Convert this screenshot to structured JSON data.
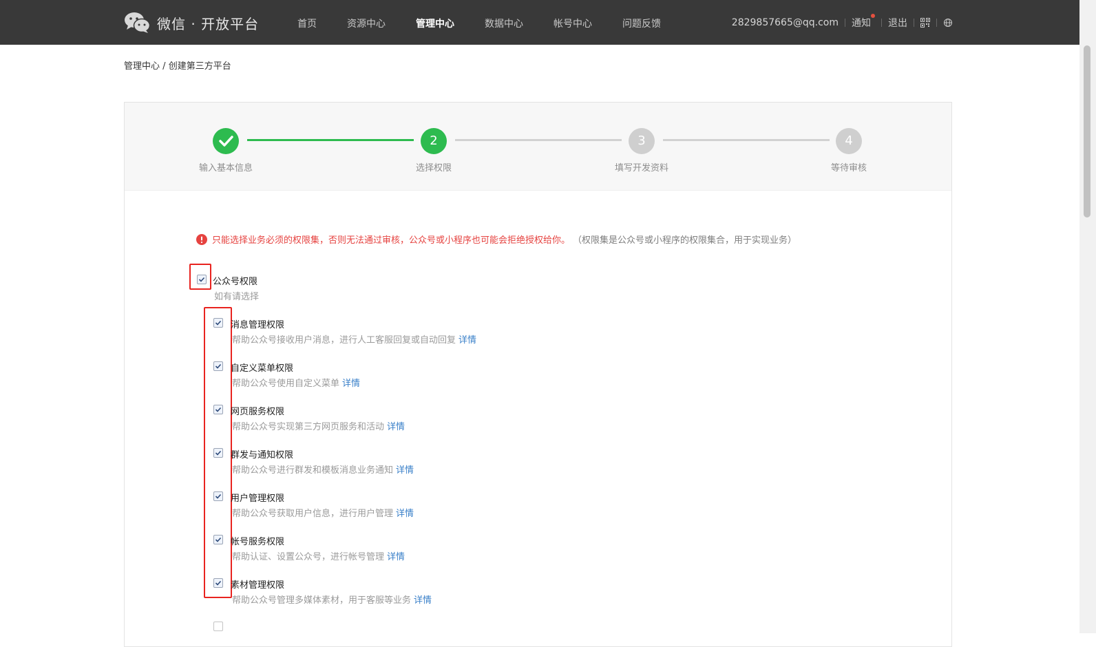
{
  "header": {
    "logo_text": "微信 · 开放平台",
    "nav": [
      {
        "label": "首页",
        "active": false
      },
      {
        "label": "资源中心",
        "active": false
      },
      {
        "label": "管理中心",
        "active": true
      },
      {
        "label": "数据中心",
        "active": false
      },
      {
        "label": "帐号中心",
        "active": false
      },
      {
        "label": "问题反馈",
        "active": false
      }
    ],
    "email": "2829857665@qq.com",
    "notify_label": "通知",
    "logout_label": "退出"
  },
  "breadcrumb": {
    "parent": "管理中心",
    "separator": "/",
    "current": "创建第三方平台"
  },
  "steps": [
    {
      "number": "1",
      "label": "输入基本信息",
      "status": "done"
    },
    {
      "number": "2",
      "label": "选择权限",
      "status": "current"
    },
    {
      "number": "3",
      "label": "填写开发资料",
      "status": "pending"
    },
    {
      "number": "4",
      "label": "等待审核",
      "status": "pending"
    }
  ],
  "warning": {
    "red_text": "只能选择业务必须的权限集，否则无法通过审核，公众号或小程序也可能会拒绝授权给你。",
    "gray_text": "（权限集是公众号或小程序的权限集合，用于实现业务）"
  },
  "group": {
    "title": "公众号权限",
    "subtitle": "如有请选择",
    "checked": true
  },
  "permissions": [
    {
      "title": "消息管理权限",
      "desc": "帮助公众号接收用户消息，进行人工客服回复或自动回复",
      "detail": "详情",
      "checked": true
    },
    {
      "title": "自定义菜单权限",
      "desc": "帮助公众号使用自定义菜单",
      "detail": "详情",
      "checked": true
    },
    {
      "title": "网页服务权限",
      "desc": "帮助公众号实现第三方网页服务和活动",
      "detail": "详情",
      "checked": true
    },
    {
      "title": "群发与通知权限",
      "desc": "帮助公众号进行群发和模板消息业务通知",
      "detail": "详情",
      "checked": true
    },
    {
      "title": "用户管理权限",
      "desc": "帮助公众号获取用户信息，进行用户管理",
      "detail": "详情",
      "checked": true
    },
    {
      "title": "帐号服务权限",
      "desc": "帮助认证、设置公众号，进行帐号管理",
      "detail": "详情",
      "checked": true
    },
    {
      "title": "素材管理权限",
      "desc": "帮助公众号管理多媒体素材，用于客服等业务",
      "detail": "详情",
      "checked": true
    }
  ],
  "colors": {
    "topbar": "#393939",
    "accent_green": "#2dbb4f",
    "warning_red": "#e64340",
    "link_blue": "#3a80c9",
    "highlight_red": "#e8231f"
  }
}
